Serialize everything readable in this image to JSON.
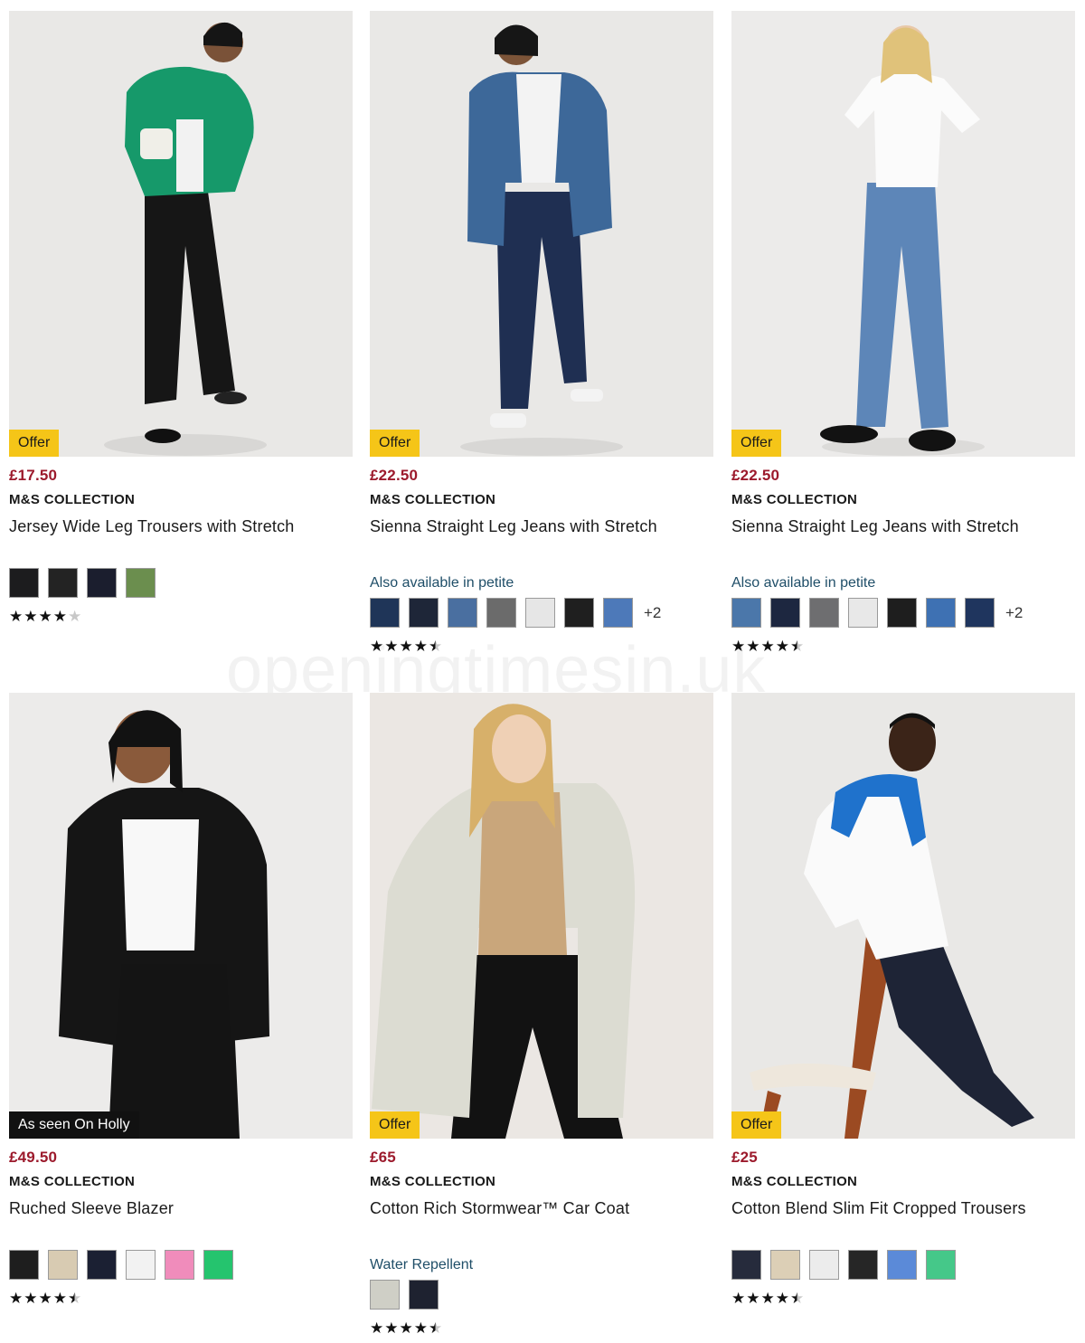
{
  "watermark": "openingtimesin.uk",
  "products": [
    {
      "badge": "Offer",
      "price": "£17.50",
      "brand": "M&S COLLECTION",
      "name": "Jersey Wide Leg Trousers with Stretch",
      "note": "",
      "swatches": [
        "#1c1c1e",
        "#232323",
        "#1b1e2e",
        "#6b8e4e"
      ],
      "more": "",
      "rating": 4,
      "image": "model-green-jacket-wide-leg-trousers"
    },
    {
      "badge": "Offer",
      "price": "£22.50",
      "brand": "M&S COLLECTION",
      "name": "Sienna Straight Leg Jeans with Stretch",
      "note": "Also available in petite",
      "swatches": [
        "#1f3558",
        "#1e2638",
        "#4a6fa0",
        "#6b6b6b",
        "#e6e6e6",
        "#1f1f1f",
        "#4d79b9"
      ],
      "more": "+2",
      "rating": 4.5,
      "image": "model-denim-jacket-dark-jeans"
    },
    {
      "badge": "Offer",
      "price": "£22.50",
      "brand": "M&S COLLECTION",
      "name": "Sienna Straight Leg Jeans with Stretch",
      "note": "Also available in petite",
      "swatches": [
        "#4b77aa",
        "#1d2740",
        "#6e6e70",
        "#e8e8e8",
        "#1e1e1e",
        "#3e71b3",
        "#1f355e"
      ],
      "more": "+2",
      "rating": 4.5,
      "image": "model-white-tee-light-jeans"
    },
    {
      "badge": "As seen On Holly",
      "price": "£49.50",
      "brand": "M&S COLLECTION",
      "name": "Ruched Sleeve Blazer",
      "note": "",
      "swatches": [
        "#1e1e1e",
        "#d8cbb2",
        "#1b2033",
        "#f2f2f2",
        "#f08cbb",
        "#25c46e"
      ],
      "more": "",
      "rating": 4.5,
      "image": "model-black-blazer"
    },
    {
      "badge": "Offer",
      "price": "£65",
      "brand": "M&S COLLECTION",
      "name": "Cotton Rich Stormwear™ Car Coat",
      "note": "Water Repellent",
      "swatches": [
        "#cfcfc6",
        "#1e2230"
      ],
      "more": "",
      "rating": 4.5,
      "image": "model-stone-car-coat"
    },
    {
      "badge": "Offer",
      "price": "£25",
      "brand": "M&S COLLECTION",
      "name": "Cotton Blend Slim Fit Cropped Trousers",
      "note": "",
      "swatches": [
        "#262b3c",
        "#dccfb6",
        "#ececec",
        "#262626",
        "#5b8ad8",
        "#45c889"
      ],
      "more": "",
      "rating": 4.5,
      "image": "model-white-shirt-cropped-trousers"
    }
  ]
}
